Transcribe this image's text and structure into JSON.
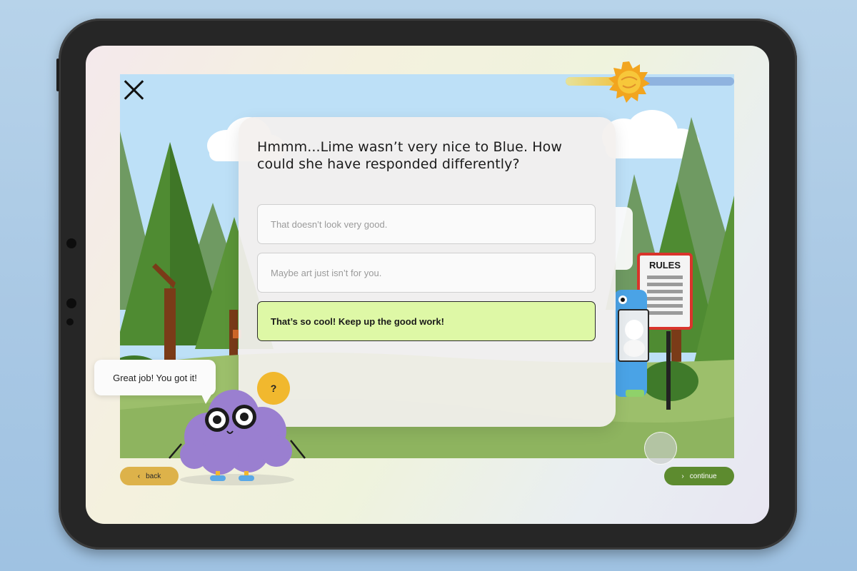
{
  "screen": {
    "close_icon": "close-icon",
    "progress": {
      "value": 0.3,
      "icon": "sun-icon"
    }
  },
  "question": {
    "text": "Hmmm...Lime wasn’t very nice to Blue. How could she have responded differently?",
    "options": [
      {
        "label": "That doesn’t look very good.",
        "selected": false
      },
      {
        "label": "Maybe art just isn’t for you.",
        "selected": false
      },
      {
        "label": "That’s so cool! Keep up the good work!",
        "selected": true
      }
    ]
  },
  "help_button": {
    "label": "?"
  },
  "character": {
    "speech": "Great job! You got it!"
  },
  "sign": {
    "label": "RULES"
  },
  "navigation": {
    "back_label": "back",
    "continue_label": "continue",
    "back_icon": "chevron-left-icon",
    "continue_icon": "chevron-right-icon"
  },
  "colors": {
    "selected_option": "#def8a6",
    "back_button": "#ddb24a",
    "continue_button": "#5d8b2f",
    "help_button": "#f1b82e",
    "character": "#9a7fd0"
  }
}
